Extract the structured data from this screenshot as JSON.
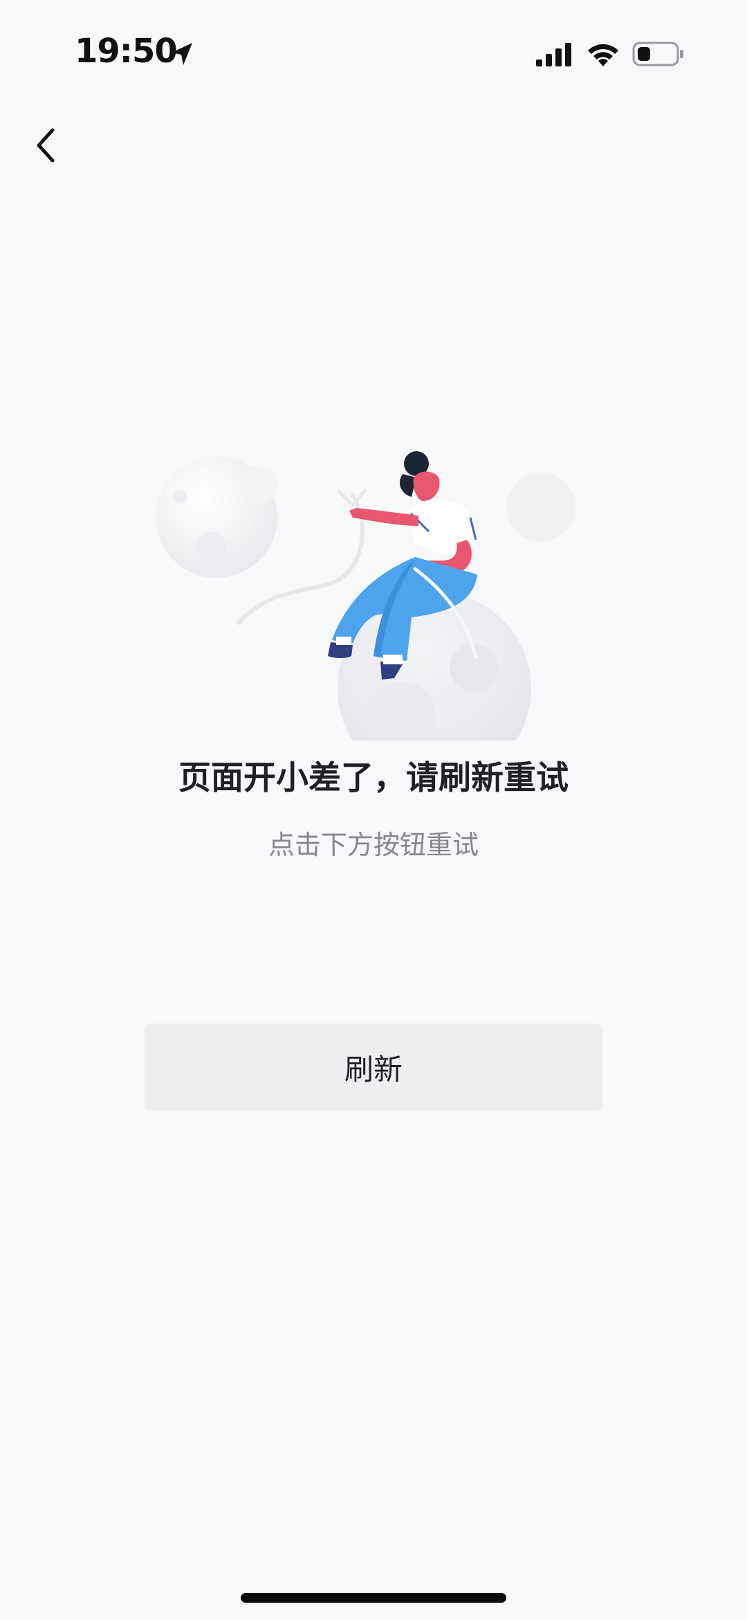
{
  "status_bar": {
    "time": "19:50",
    "icons": [
      "location-arrow-icon",
      "signal-icon",
      "wifi-icon",
      "battery-icon"
    ]
  },
  "nav": {
    "back_icon": "chevron-left-icon"
  },
  "error": {
    "title": "页面开小差了，请刷新重试",
    "subtitle": "点击下方按钮重试"
  },
  "actions": {
    "refresh_label": "刷新"
  },
  "colors": {
    "background": "#f7f8fa",
    "button_bg": "#eeeef0",
    "title_text": "#1f1f24",
    "subtitle_text": "#86868c",
    "illustration_pink": "#e8566f",
    "illustration_blue": "#4da3ec"
  }
}
